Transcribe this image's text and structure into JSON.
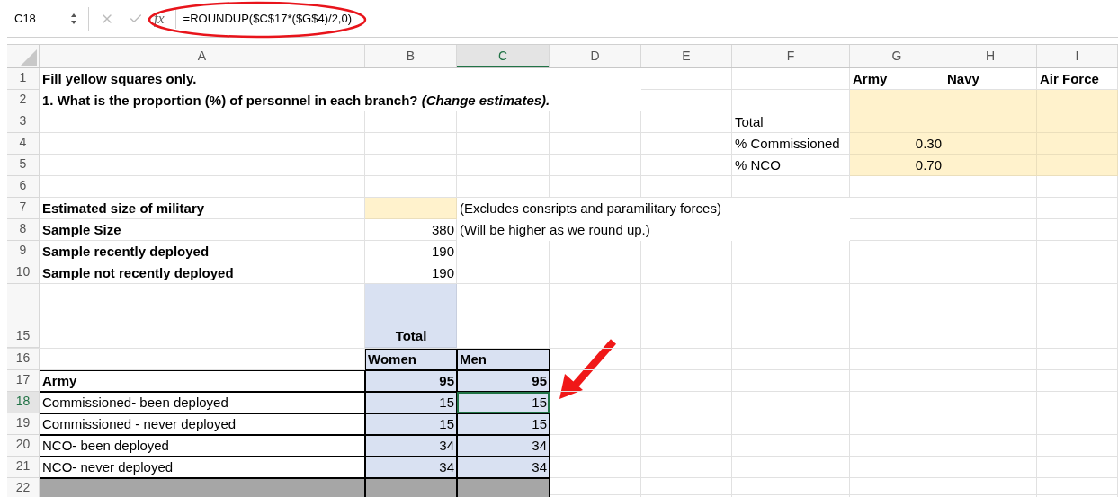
{
  "formula_bar": {
    "name_box": "C18",
    "function_label": "fx",
    "formula": "=ROUNDUP($C$17*($G$4)/2,0)"
  },
  "columns": [
    {
      "label": "A",
      "selected": false
    },
    {
      "label": "B",
      "selected": false
    },
    {
      "label": "C",
      "selected": true
    },
    {
      "label": "D",
      "selected": false
    },
    {
      "label": "E",
      "selected": false
    },
    {
      "label": "F",
      "selected": false
    },
    {
      "label": "G",
      "selected": false
    },
    {
      "label": "H",
      "selected": false
    },
    {
      "label": "I",
      "selected": false
    }
  ],
  "rows": [
    {
      "number": "1",
      "selected": false,
      "kind": "normal",
      "cells": [
        {
          "text": "Fill yellow squares only.",
          "bold": true
        },
        {},
        {},
        {},
        {},
        {},
        {
          "text": "Army",
          "bold": true
        },
        {
          "text": "Navy",
          "bold": true
        },
        {
          "text": "Air Force",
          "bold": true
        }
      ]
    },
    {
      "number": "2",
      "selected": false,
      "kind": "normal",
      "cells": [
        {
          "text": "1. What is the proportion (%) of personnel in each branch? *(Change estimates).*",
          "bold": true
        },
        {},
        {},
        {},
        {},
        {},
        {
          "color": "#fff2cc"
        },
        {
          "color": "#fff2cc"
        },
        {
          "color": "#fff2cc"
        }
      ]
    },
    {
      "number": "3",
      "selected": false,
      "kind": "normal",
      "cells": [
        {},
        {},
        {},
        {},
        {},
        {
          "text": "Total"
        },
        {
          "color": "#fff2cc"
        },
        {
          "color": "#fff2cc"
        },
        {
          "color": "#fff2cc"
        }
      ]
    },
    {
      "number": "4",
      "selected": false,
      "kind": "normal",
      "cells": [
        {},
        {},
        {},
        {},
        {},
        {
          "text": "% Commissioned"
        },
        {
          "text": "0.30",
          "right_aligned": true,
          "color": "#fff2cc"
        },
        {
          "color": "#fff2cc"
        },
        {
          "color": "#fff2cc"
        }
      ]
    },
    {
      "number": "5",
      "selected": false,
      "kind": "normal",
      "cells": [
        {},
        {},
        {},
        {},
        {},
        {
          "text": "% NCO"
        },
        {
          "text": "0.70",
          "right_aligned": true,
          "color": "#fff2cc"
        },
        {
          "color": "#fff2cc"
        },
        {
          "color": "#fff2cc"
        }
      ]
    },
    {
      "number": "6",
      "selected": false,
      "kind": "normal",
      "cells": [
        {},
        {},
        {},
        {},
        {},
        {},
        {},
        {},
        {}
      ]
    },
    {
      "number": "7",
      "selected": false,
      "kind": "normal",
      "cells": [
        {
          "text": "Estimated size of military",
          "bold": true
        },
        {
          "color": "#fff2cc"
        },
        {
          "text": "(Excludes consripts and paramilitary forces)"
        },
        {},
        {},
        {},
        {},
        {},
        {}
      ]
    },
    {
      "number": "8",
      "selected": false,
      "kind": "normal",
      "cells": [
        {
          "text": "Sample Size",
          "bold": true
        },
        {
          "text": "380",
          "right_aligned": true
        },
        {
          "text": "(Will be higher as we round up.)"
        },
        {},
        {},
        {},
        {},
        {},
        {}
      ]
    },
    {
      "number": "9",
      "selected": false,
      "kind": "normal",
      "cells": [
        {
          "text": "Sample recently deployed",
          "bold": true
        },
        {
          "text": "190",
          "right_aligned": true
        },
        {},
        {},
        {},
        {},
        {},
        {},
        {}
      ]
    },
    {
      "number": "10",
      "selected": false,
      "kind": "normal",
      "cells": [
        {
          "text": "Sample not recently deployed",
          "bold": true
        },
        {
          "text": "190",
          "right_aligned": true
        },
        {},
        {},
        {},
        {},
        {},
        {},
        {}
      ]
    },
    {
      "number": "15",
      "selected": false,
      "kind": "tall",
      "cells": [
        {},
        {
          "text": "Total",
          "bold": true,
          "centered": true,
          "color": "#d9e1f2"
        },
        {},
        {},
        {},
        {},
        {},
        {}
      ]
    },
    {
      "number": "16",
      "selected": false,
      "kind": "normal",
      "cells": [
        {},
        {
          "text": "Women",
          "bold": true,
          "color": "#d9e1f2",
          "boxed": true
        },
        {
          "text": "Men",
          "bold": true,
          "color": "#d9e1f2",
          "boxed": true
        },
        {},
        {},
        {},
        {},
        {},
        {}
      ]
    },
    {
      "number": "17",
      "selected": false,
      "kind": "normal",
      "cells": [
        {
          "text": "Army",
          "bold": true,
          "boxed": true
        },
        {
          "text": "95",
          "bold": true,
          "right_aligned": true,
          "color": "#d9e1f2",
          "boxed": true
        },
        {
          "text": "95",
          "bold": true,
          "right_aligned": true,
          "color": "#d9e1f2",
          "boxed": true
        },
        {},
        {},
        {},
        {},
        {},
        {}
      ]
    },
    {
      "number": "18",
      "selected": true,
      "kind": "normal",
      "cells": [
        {
          "text": "Commissioned- been deployed",
          "boxed": true
        },
        {
          "text": "15",
          "right_aligned": true,
          "color": "#d9e1f2",
          "boxed": true
        },
        {
          "text": "15",
          "right_aligned": true,
          "color": "#d9e1f2",
          "boxed": true
        },
        {},
        {},
        {},
        {},
        {},
        {}
      ]
    },
    {
      "number": "19",
      "selected": false,
      "kind": "normal",
      "cells": [
        {
          "text": "Commissioned - never deployed",
          "boxed": true
        },
        {
          "text": "15",
          "right_aligned": true,
          "color": "#d9e1f2",
          "boxed": true
        },
        {
          "text": "15",
          "right_aligned": true,
          "color": "#d9e1f2",
          "boxed": true
        },
        {},
        {},
        {},
        {},
        {},
        {}
      ]
    },
    {
      "number": "20",
      "selected": false,
      "kind": "normal",
      "cells": [
        {
          "text": "NCO- been deployed",
          "boxed": true
        },
        {
          "text": "34",
          "right_aligned": true,
          "color": "#d9e1f2",
          "boxed": true
        },
        {
          "text": "34",
          "right_aligned": true,
          "color": "#d9e1f2",
          "boxed": true
        },
        {},
        {},
        {},
        {},
        {},
        {}
      ]
    },
    {
      "number": "21",
      "selected": false,
      "kind": "normal",
      "cells": [
        {
          "text": "NCO- never deployed",
          "boxed": true
        },
        {
          "text": "34",
          "right_aligned": true,
          "color": "#d9e1f2",
          "boxed": true
        },
        {
          "text": "34",
          "right_aligned": true,
          "color": "#d9e1f2",
          "boxed": true
        },
        {},
        {},
        {},
        {},
        {},
        {}
      ]
    },
    {
      "number": "22",
      "selected": false,
      "kind": "cut",
      "cells": [
        {
          "color": "#a6a6a6",
          "boxed": true
        },
        {
          "color": "#a6a6a6",
          "boxed": true
        },
        {
          "color": "#a6a6a6",
          "boxed": true
        },
        {},
        {},
        {},
        {},
        {},
        {}
      ]
    }
  ]
}
